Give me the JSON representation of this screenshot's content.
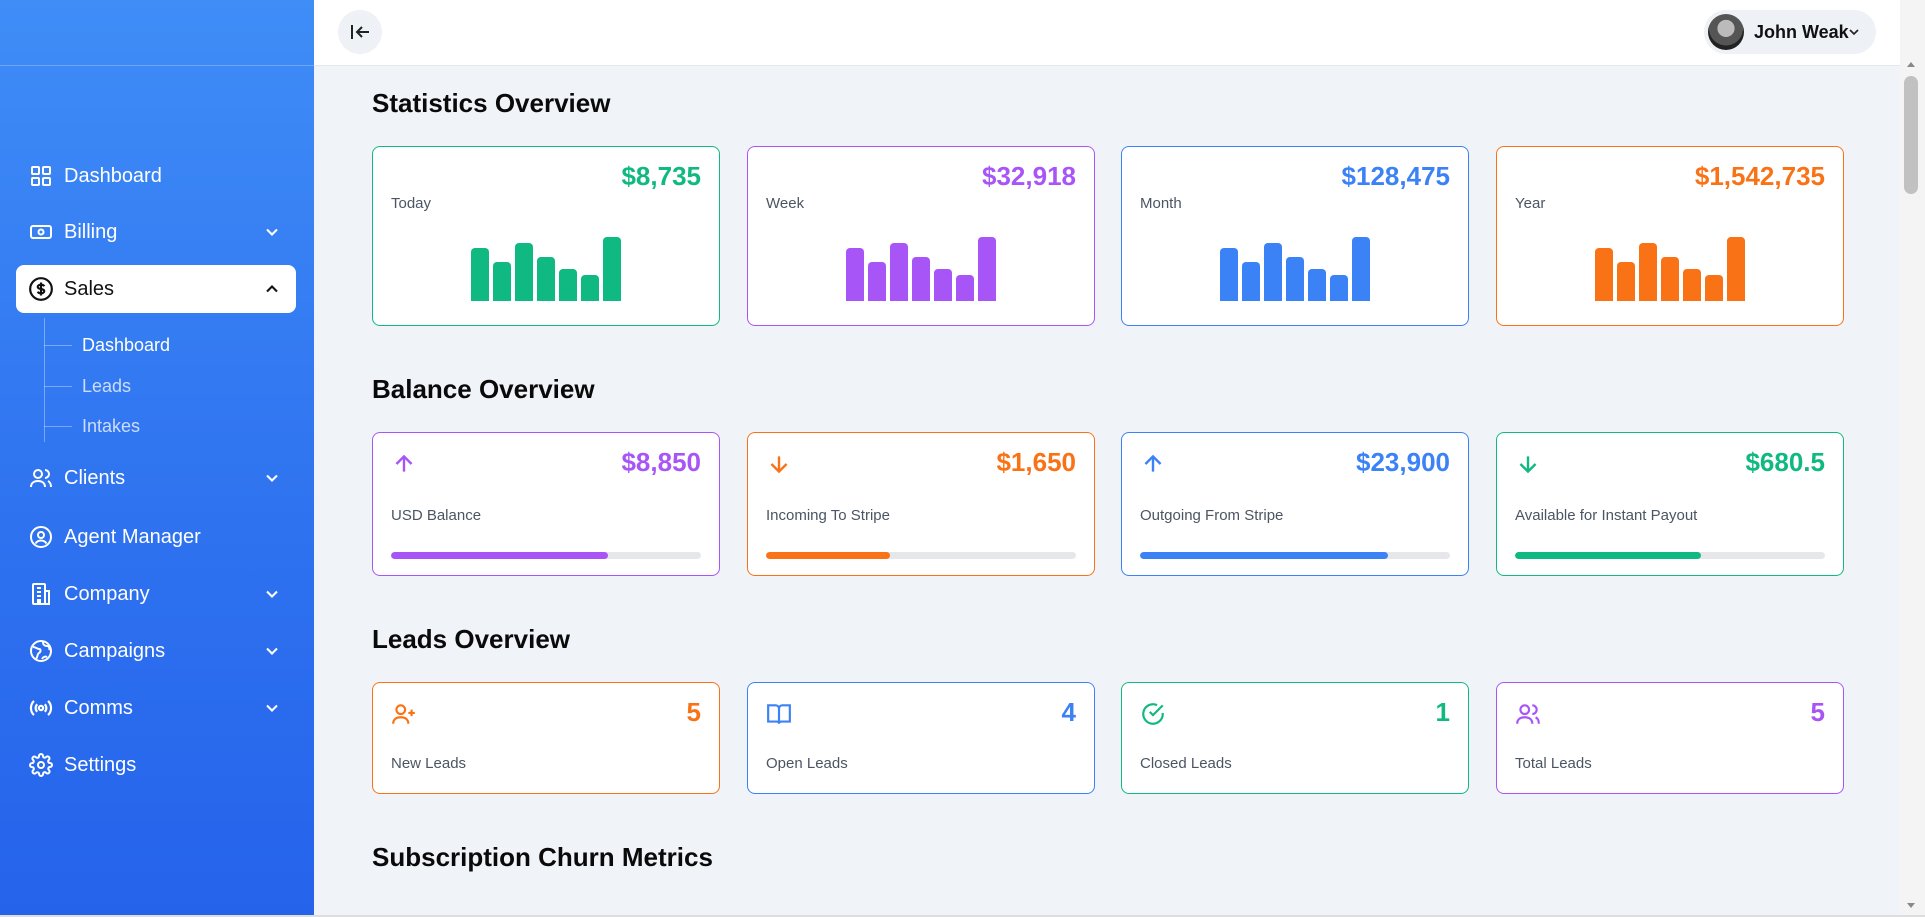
{
  "sidebar": {
    "items": [
      {
        "label": "Dashboard",
        "icon": "grid-icon",
        "has_chevron": false
      },
      {
        "label": "Billing",
        "icon": "banknote-icon",
        "has_chevron": true
      },
      {
        "label": "Sales",
        "icon": "dollar-circle-icon",
        "has_chevron": true,
        "active": true
      },
      {
        "label": "Clients",
        "icon": "users-icon",
        "has_chevron": true
      },
      {
        "label": "Agent Manager",
        "icon": "user-circle-icon",
        "has_chevron": false
      },
      {
        "label": "Company",
        "icon": "building-icon",
        "has_chevron": true
      },
      {
        "label": "Campaigns",
        "icon": "globe-icon",
        "has_chevron": true
      },
      {
        "label": "Comms",
        "icon": "broadcast-icon",
        "has_chevron": true
      },
      {
        "label": "Settings",
        "icon": "gear-icon",
        "has_chevron": false
      }
    ],
    "sales_sub": [
      "Dashboard",
      "Leads",
      "Intakes"
    ]
  },
  "header": {
    "user_name": "John Weak"
  },
  "sections": {
    "statistics": "Statistics Overview",
    "balance": "Balance Overview",
    "leads": "Leads Overview",
    "churn": "Subscription Churn Metrics"
  },
  "statistics": [
    {
      "label": "Today",
      "amount": "$8,735",
      "color": "#10b981",
      "bars": [
        0.75,
        0.56,
        0.83,
        0.63,
        0.46,
        0.37,
        0.92
      ]
    },
    {
      "label": "Week",
      "amount": "$32,918",
      "color": "#a855f7",
      "bars": [
        0.75,
        0.56,
        0.83,
        0.63,
        0.46,
        0.37,
        0.92
      ]
    },
    {
      "label": "Month",
      "amount": "$128,475",
      "color": "#3b82f6",
      "bars": [
        0.75,
        0.56,
        0.83,
        0.63,
        0.46,
        0.37,
        0.92
      ]
    },
    {
      "label": "Year",
      "amount": "$1,542,735",
      "color": "#f97316",
      "bars": [
        0.75,
        0.56,
        0.83,
        0.63,
        0.46,
        0.37,
        0.92
      ]
    }
  ],
  "balance": [
    {
      "label": "USD Balance",
      "amount": "$8,850",
      "color": "#a855f7",
      "icon": "arrow-up-icon",
      "progress": 0.7
    },
    {
      "label": "Incoming To Stripe",
      "amount": "$1,650",
      "color": "#f97316",
      "icon": "arrow-down-icon",
      "progress": 0.4
    },
    {
      "label": "Outgoing From Stripe",
      "amount": "$23,900",
      "color": "#3b82f6",
      "icon": "arrow-up-icon",
      "progress": 0.8
    },
    {
      "label": "Available for Instant Payout",
      "amount": "$680.5",
      "color": "#10b981",
      "icon": "arrow-down-icon",
      "progress": 0.6
    }
  ],
  "leads": [
    {
      "label": "New Leads",
      "count": "5",
      "color": "#f97316",
      "icon": "user-plus-icon"
    },
    {
      "label": "Open Leads",
      "count": "4",
      "color": "#3b82f6",
      "icon": "book-open-icon"
    },
    {
      "label": "Closed Leads",
      "count": "1",
      "color": "#10b981",
      "icon": "check-circle-icon"
    },
    {
      "label": "Total Leads",
      "count": "5",
      "color": "#a855f7",
      "icon": "users-icon"
    }
  ]
}
